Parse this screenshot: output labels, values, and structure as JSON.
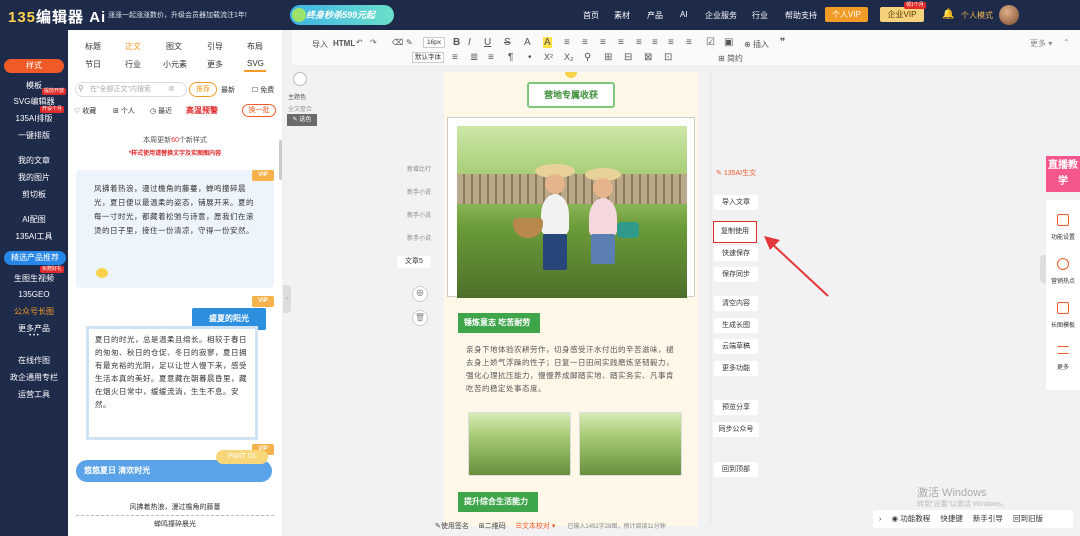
{
  "header": {
    "logo_prefix": "135",
    "logo_text": "编辑器",
    "logo_ai": "Ai",
    "notice": "涨涨一起涨涨数价，升级会员器加载流注1年!",
    "promo": "终身秒杀599元起",
    "nav": [
      "首页",
      "素材",
      "产品",
      "AI",
      "企业服务",
      "行业",
      "帮助支持"
    ],
    "personal_vip": "个人VIP",
    "enterprise_vip": "企业VIP",
    "enterprise_tag": "领1个月",
    "user_mode": "个人模式"
  },
  "sidebar": {
    "items": [
      "样式",
      "模板",
      "SVG编辑器",
      "135AI排版",
      "一键排版",
      "我的文章",
      "我的图片",
      "剪切板",
      "AI配图",
      "135AI工具",
      "精选产品推荐",
      "生图生视频",
      "135GEO",
      "公众号长图",
      "更多产品",
      "在线作图",
      "政企通用专栏",
      "运营工具"
    ],
    "tags": [
      "提前开放",
      "开设个月",
      "买赠好礼"
    ],
    "more_dots": "• • •"
  },
  "panel": {
    "tabs_row1": [
      "标题",
      "正文",
      "图文",
      "引导",
      "布局"
    ],
    "tabs_row2": [
      "节日",
      "行业",
      "小元素",
      "更多",
      "SVG"
    ],
    "search_placeholder": "在\"全部正文\"内搜索",
    "recommend": "推荐",
    "latest": "最新",
    "free": "免费",
    "filter": [
      "收藏",
      "个人",
      "最近"
    ],
    "premium": "高温预警",
    "change_batch": "换一批",
    "weekly_prefix": "本周更新",
    "weekly_count": "60",
    "weekly_suffix": "个新样式",
    "weekly_note": "*样式使用请替换文字及实图图内容",
    "card1_text": "风拂着热浪，漫过檐角的藤蔓，蝉鸣撞碎晨光，夏日便以最温柔的姿态，铺展开来。夏的每一寸时光，都藏着松弛与诗意，愿我们在滚烫的日子里，接住一份清凉，守得一份安然。",
    "card2_title": "盛夏的阳光",
    "card2_text": "夏日的时光，总是温柔且绵长。相较于春日的匆匆、秋日的仓促、冬日的寂寥，夏日拥有最充裕的光阴，足以让世人慢下来，感受生活本真的美好。夏意藏在朝暮晨昏里，藏在烟火日常中，缓缓流淌，生生不息。安然。",
    "card3_title": "悠悠夏日 清欢时光",
    "card3_part": "PART 01",
    "card3_line1": "风拂着热浪，漫过檐角的藤蔓",
    "card3_line2": "蝉鸣撞碎晨光",
    "vip": "VIP"
  },
  "toolbar": {
    "row1": [
      "导入",
      "HTML",
      "↶",
      "↷",
      "⌫",
      "✎",
      "16px",
      "B",
      "I",
      "U",
      "S",
      "A",
      "A",
      "≡",
      "≡",
      "≡",
      "≡",
      "≡",
      "≡",
      "≡",
      "≡",
      "☑",
      "▣",
      "插入",
      "❞"
    ],
    "font": "默认字体",
    "more": "更多",
    "row2": [
      "≡",
      "≣",
      "≡",
      "¶",
      "•",
      "X²",
      "X₂",
      "⚲",
      "⊞",
      "⊟",
      "⊠",
      "⊡",
      "简约"
    ]
  },
  "editor": {
    "theme_label": "主题色",
    "theme_sub": "全文整合",
    "theme_btn": "✎ 选色",
    "history": [
      "新增比行",
      "新手小说",
      "新手小说",
      "新手小说"
    ],
    "article_tab": "文章5",
    "add": "⊕",
    "delete": "🗑",
    "title": "营地专属收获",
    "tag1": "锤炼意志 吃苦耐劳",
    "body": "亲身下地体验农耕劳作，切身感受汗水付出的辛苦滋味，褪去身上娇气浮躁的性子；日复一日田间实践磨炼坚韧毅力，强化心理抗压能力，慢慢养成脚踏实地、踏实务实、凡事肯吃苦的稳定处事态度。",
    "tag2": "提升综合生活能力"
  },
  "actions": {
    "ai_label": "135AI生文",
    "buttons": [
      "导入文章",
      "复制使用",
      "快速保存",
      "保存同步",
      "清空内容",
      "生成长图",
      "云端草稿",
      "更多功能",
      "预览分享",
      "同步公众号",
      "回到顶部"
    ]
  },
  "right_tools": {
    "live": "直播教学",
    "items": [
      "功能设置",
      "营销热点",
      "长图模板",
      "更多"
    ]
  },
  "bottom": {
    "items": [
      "使用签名",
      "二维码",
      "文本校对"
    ],
    "status": "已输入1492字28图，预计阅读11分钟",
    "right": [
      "功能教程",
      "快捷键",
      "新手引导",
      "回到旧版"
    ]
  },
  "watermark": {
    "line1": "激活 Windows",
    "line2": "转到\"设置\"以激活 Windows。"
  }
}
